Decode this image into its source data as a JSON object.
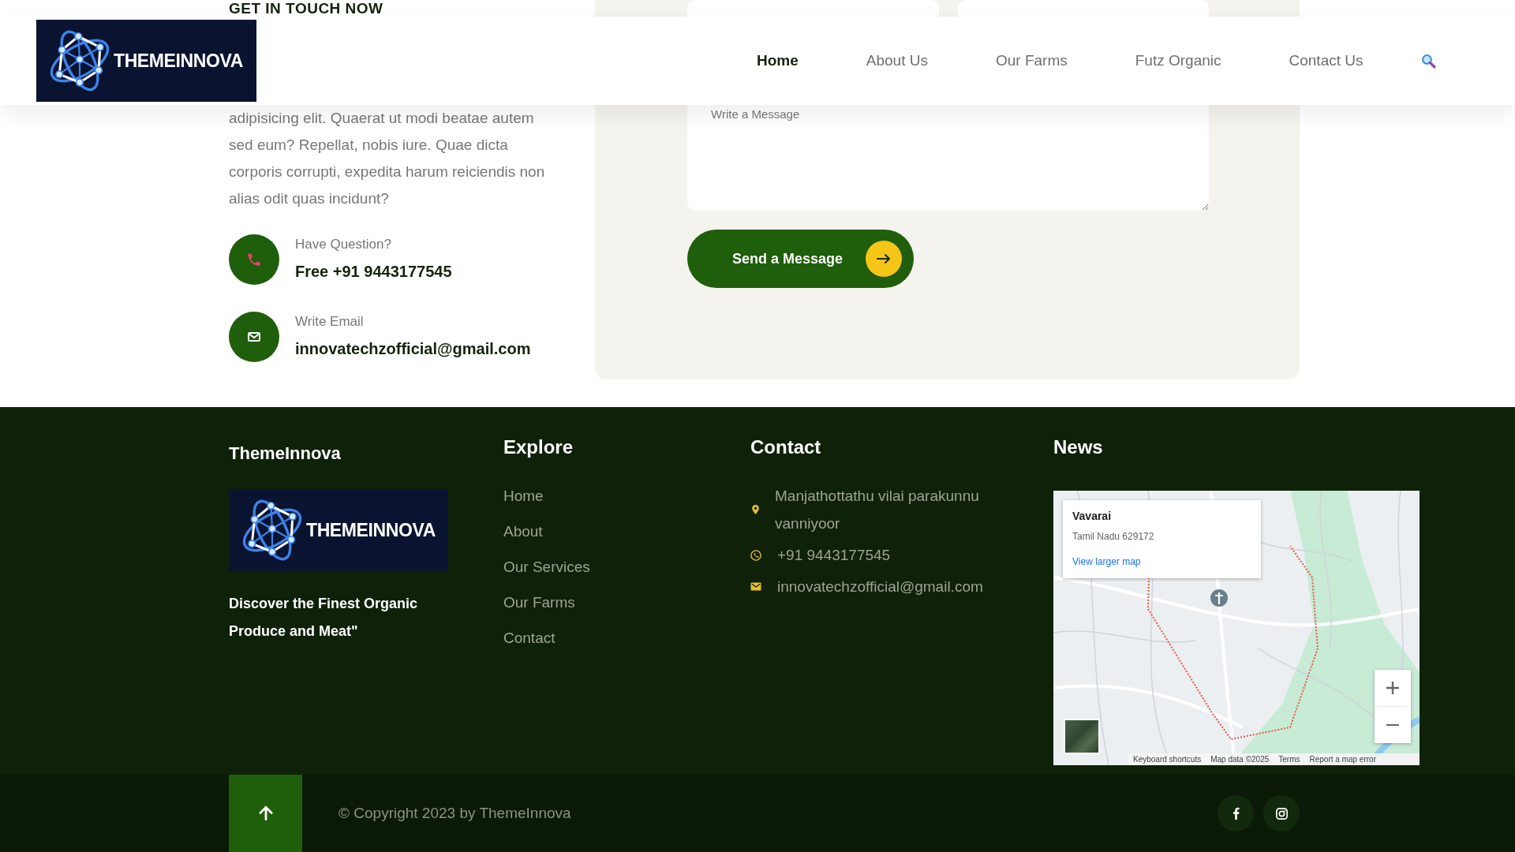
{
  "contact": {
    "heading": "GET IN TOUCH NOW",
    "paragraph": "adipisicing elit. Quaerat ut modi beatae autem sed eum? Repellat, nobis iure. Quae dicta corporis corrupti, expedita harum reiciendis non alias odit quas incidunt?",
    "items": [
      {
        "kind": "phone",
        "label": "Have Question?",
        "value": "Free +91 9443177545"
      },
      {
        "kind": "email",
        "label": "Write Email",
        "value": "innovatechzofficial@gmail.com"
      }
    ]
  },
  "form": {
    "message": {
      "placeholder": "Write a Message"
    },
    "submit": {
      "label": "Send a Message"
    }
  },
  "header": {
    "logo": {
      "text": "THEMEINNOVA"
    },
    "nav": [
      {
        "label": "Home",
        "selected": true
      },
      {
        "label": "About Us",
        "selected": false
      },
      {
        "label": "Our Farms",
        "selected": false
      },
      {
        "label": "Futz Organic",
        "selected": false
      },
      {
        "label": "Contact Us",
        "selected": false
      }
    ]
  },
  "footer": {
    "brand": {
      "title": "ThemeInnova",
      "logo_text": "THEMEINNOVA",
      "tagline": "Discover the Finest Organic Produce and Meat\""
    },
    "explore": {
      "title": "Explore",
      "links": [
        "Home",
        "About",
        "Our Services",
        "Our Farms",
        "Contact"
      ]
    },
    "contact": {
      "title": "Contact",
      "items": [
        {
          "kind": "address",
          "text": "Manjathottathu vilai parakunnu vanniyoor"
        },
        {
          "kind": "phone",
          "text": "+91 9443177545"
        },
        {
          "kind": "email",
          "text": "innovatechzofficial@gmail.com"
        }
      ]
    },
    "news": {
      "title": "News",
      "map": {
        "place": "Vavarai",
        "address": "Tamil Nadu 629172",
        "link": "View larger map",
        "attribution": [
          "Keyboard shortcuts",
          "Map data ©2025",
          "Terms",
          "Report a map error"
        ]
      }
    }
  },
  "bottom_bar": {
    "copyright": "© Copyright 2023 by ThemeInnova",
    "social": [
      {
        "kind": "facebook"
      },
      {
        "kind": "instagram"
      }
    ]
  }
}
